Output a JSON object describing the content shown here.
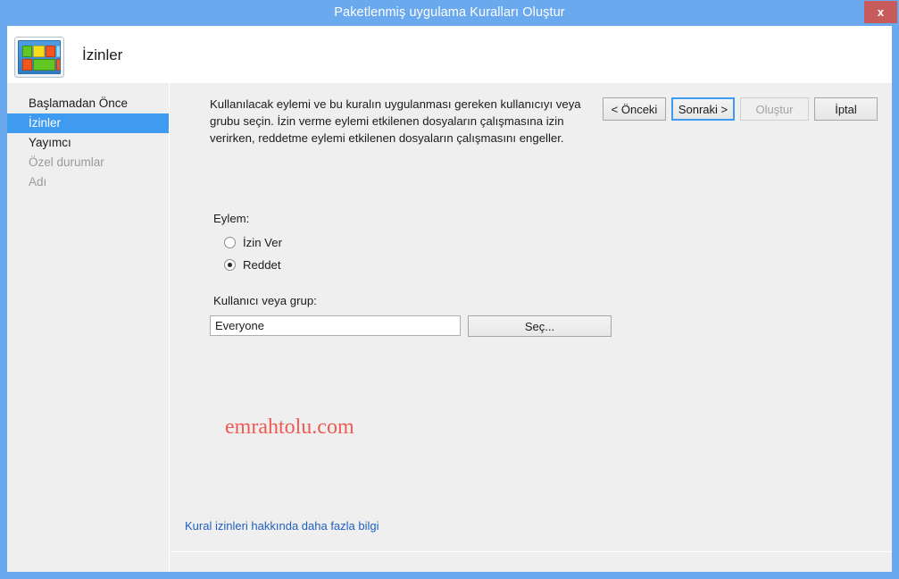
{
  "window": {
    "title": "Paketlenmiş uygulama Kuralları Oluştur",
    "close_label": "x",
    "accent_blue": "#6aa9ee",
    "close_red": "#c75b5b"
  },
  "header": {
    "page_title": "İzinler",
    "icon": "packaged-app-rules-icon"
  },
  "sidebar": {
    "items": [
      {
        "label": "Başlamadan Önce",
        "state": "normal"
      },
      {
        "label": "İzinler",
        "state": "selected"
      },
      {
        "label": "Yayımcı",
        "state": "normal"
      },
      {
        "label": "Özel durumlar",
        "state": "disabled"
      },
      {
        "label": "Adı",
        "state": "disabled"
      }
    ],
    "selected_index": 1,
    "selected_bg": "#3f9bf0"
  },
  "content": {
    "description": "Kullanılacak eylemi ve bu kuralın uygulanması gereken kullanıcıyı veya grubu seçin. İzin verme eylemi etkilenen dosyaların çalışmasına izin verirken, reddetme eylemi etkilenen dosyaların çalışmasını engeller.",
    "action": {
      "group_label": "Eylem:",
      "options": [
        {
          "label": "İzin Ver",
          "checked": false
        },
        {
          "label": "Reddet",
          "checked": true
        }
      ],
      "selected": "Reddet"
    },
    "principal": {
      "label": "Kullanıcı veya grup:",
      "value": "Everyone",
      "placeholder": "",
      "select_button_label": "Seç..."
    },
    "watermark": {
      "text": "emrahtolu.com",
      "color": "#ef5b52"
    },
    "help_link": {
      "label": "Kural izinleri hakkında daha fazla bilgi",
      "color": "#1f5fbf"
    }
  },
  "footer": {
    "buttons": [
      {
        "label": "< Önceki",
        "state": "enabled"
      },
      {
        "label": "Sonraki >",
        "state": "default-focused"
      },
      {
        "label": "Oluştur",
        "state": "disabled"
      },
      {
        "label": "İptal",
        "state": "enabled"
      }
    ],
    "previous_label": "< Önceki",
    "next_label": "Sonraki >",
    "create_label": "Oluştur",
    "cancel_label": "İptal"
  }
}
